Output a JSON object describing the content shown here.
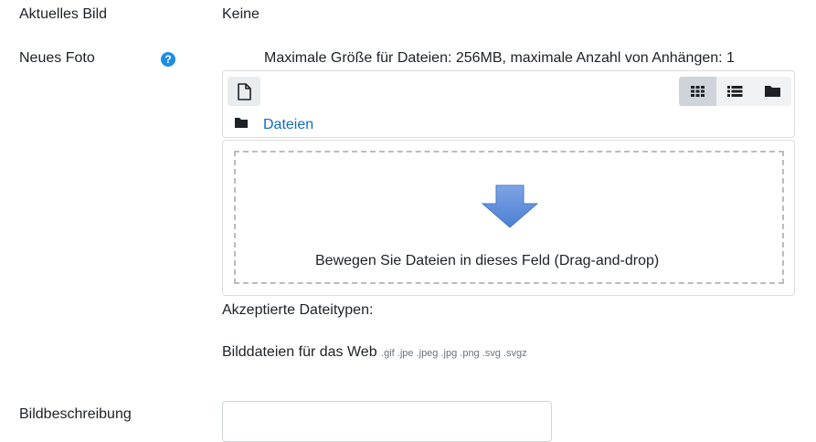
{
  "current_image": {
    "label": "Aktuelles Bild",
    "value": "Keine"
  },
  "new_photo": {
    "label": "Neues Foto",
    "help_icon": "question-circle-icon",
    "limits_text": "Maximale Größe für Dateien: 256MB, maximale Anzahl von Anhängen: 1"
  },
  "filemanager": {
    "new_file_icon": "file-icon",
    "views": [
      {
        "icon": "grid-view-icon",
        "active": true
      },
      {
        "icon": "list-view-icon",
        "active": false
      },
      {
        "icon": "folder-tree-icon",
        "active": false
      }
    ],
    "path_icon": "folder-icon",
    "path_label": "Dateien",
    "drop_icon": "arrow-down-icon",
    "drop_text": "Bewegen Sie Dateien in dieses Feld (Drag-and-drop)",
    "arrow_color": "#5b8bd8"
  },
  "accepted": {
    "heading": "Akzeptierte Dateitypen:",
    "group": "Bilddateien für das Web",
    "extensions": ".gif .jpe .jpeg .jpg .png .svg .svgz"
  },
  "description": {
    "label": "Bildbeschreibung",
    "value": ""
  }
}
